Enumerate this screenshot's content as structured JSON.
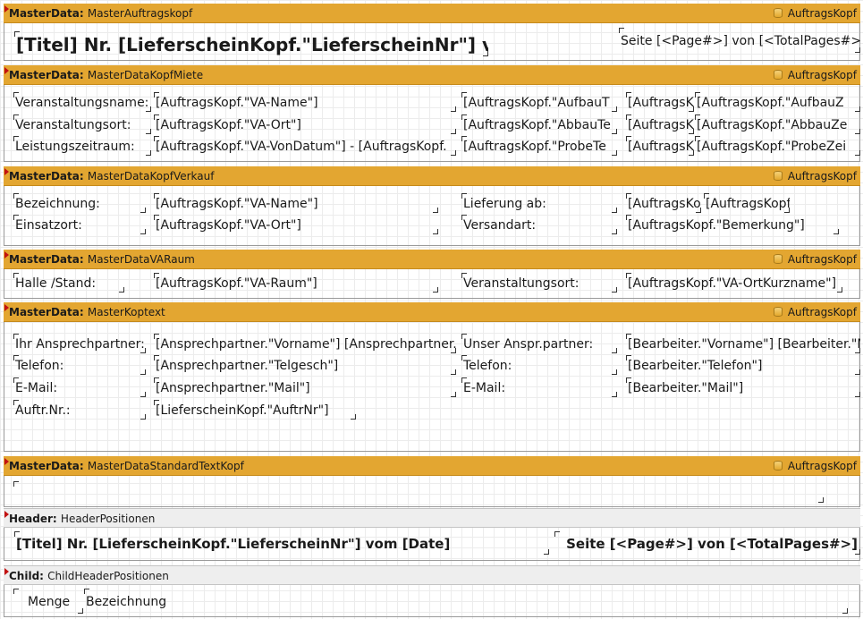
{
  "bands": [
    {
      "type": "MasterData:",
      "name": "MasterAuftragskopf",
      "source": "AuftragsKopf"
    },
    {
      "type": "MasterData:",
      "name": "MasterDataKopfMiete",
      "source": "AuftragsKopf"
    },
    {
      "type": "MasterData:",
      "name": "MasterDataKopfVerkauf",
      "source": "AuftragsKopf"
    },
    {
      "type": "MasterData:",
      "name": "MasterDataVARaum",
      "source": "AuftragsKopf"
    },
    {
      "type": "MasterData:",
      "name": "MasterKoptext",
      "source": "AuftragsKopf"
    },
    {
      "type": "MasterData:",
      "name": "MasterDataStandardTextKopf",
      "source": "AuftragsKopf"
    },
    {
      "type": "Header:",
      "name": "HeaderPositionen",
      "source": ""
    },
    {
      "type": "Child:",
      "name": "ChildHeaderPositionen",
      "source": ""
    }
  ],
  "auftragskopf": {
    "title": "[Titel] Nr. [LieferscheinKopf.\"LieferscheinNr\"] vom [D",
    "page": "Seite [<Page#>] von [<TotalPages#>]"
  },
  "miete": {
    "label1": "Veranstaltungsname:",
    "value1": "[AuftragsKopf.\"VA-Name\"]",
    "label2": "Veranstaltungsort:",
    "value2": "[AuftragsKopf.\"VA-Ort\"]",
    "label3": "Leistungszeitraum:",
    "value3": "[AuftragsKopf.\"VA-VonDatum\"] - [AuftragsKopf.",
    "c3_1": "[AuftragsKopf.\"AufbauT",
    "c3_2": "[AuftragsKopf.\"AbbauTe",
    "c3_3": "[AuftragsKopf.\"ProbeTe",
    "c4_1": "[AuftragsK",
    "c4_2": "[AuftragsK",
    "c4_3": "[AuftragsK",
    "c5_1": "[AuftragsKopf.\"AufbauZ",
    "c5_2": "[AuftragsKopf.\"AbbauZe",
    "c5_3": "[AuftragsKopf.\"ProbeZei"
  },
  "verkauf": {
    "label1": "Bezeichnung:",
    "value1": "[AuftragsKopf.\"VA-Name\"]",
    "label2": "Einsatzort:",
    "value2": "[AuftragsKopf.\"VA-Ort\"]",
    "label3": "Lieferung ab:",
    "label4": "Versandart:",
    "value3a": "[AuftragsKo",
    "value3b": "[AuftragsKopf",
    "value4": "[AuftragsKopf.\"Bemerkung\"]"
  },
  "varaum": {
    "label1": "Halle /Stand:",
    "value1": "[AuftragsKopf.\"VA-Raum\"]",
    "label2": "Veranstaltungsort:",
    "value2": "[AuftragsKopf.\"VA-OrtKurzname\"]"
  },
  "koptext": {
    "l1": "Ihr Ansprechpartner:",
    "v1": "[Ansprechpartner.\"Vorname\"] [Ansprechpartner.\"",
    "l2": "Telefon:",
    "v2": "[Ansprechpartner.\"Telgesch\"]",
    "l3": "E-Mail:",
    "v3": "[Ansprechpartner.\"Mail\"]",
    "l4": "Auftr.Nr.:",
    "v4": "[LieferscheinKopf.\"AuftrNr\"]",
    "r1": "Unser Anspr.partner:",
    "rv1": "[Bearbeiter.\"Vorname\"] [Bearbeiter.\"Na",
    "r2": "Telefon:",
    "rv2": "[Bearbeiter.\"Telefon\"]",
    "r3": "E-Mail:",
    "rv3": "[Bearbeiter.\"Mail\"]"
  },
  "headerpos": {
    "title": "[Titel] Nr. [LieferscheinKopf.\"LieferscheinNr\"] vom [Date]",
    "page": "Seite [<Page#>] von [<TotalPages#>]"
  },
  "childheader": {
    "menge": "Menge",
    "bezeichnung": "Bezeichnung"
  }
}
